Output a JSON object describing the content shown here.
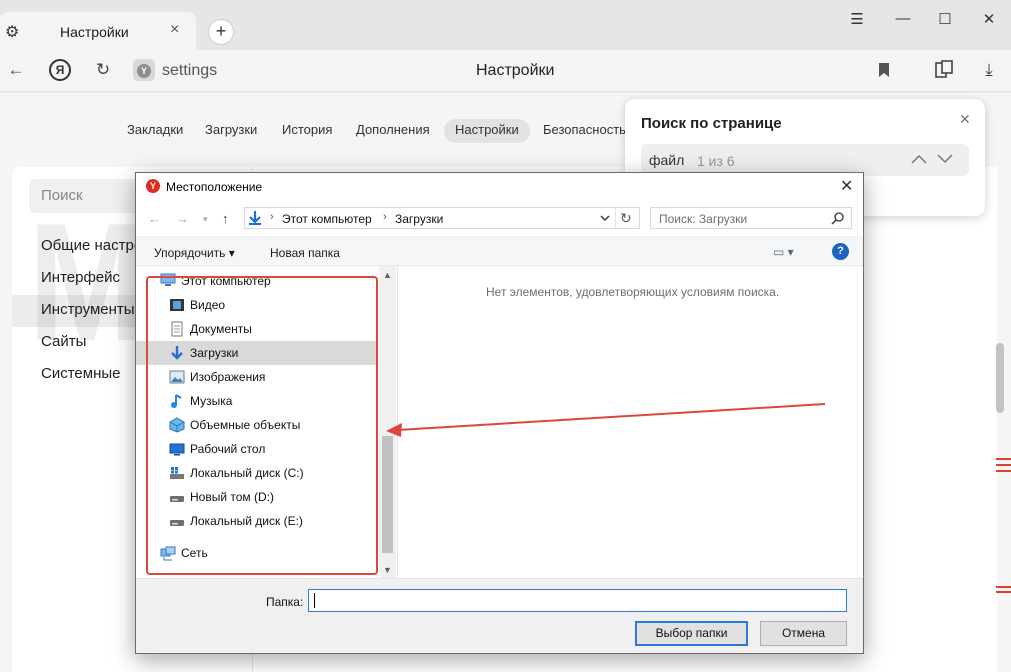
{
  "browser": {
    "tab_title": "Настройки",
    "tab_close": "×",
    "new_tab": "+",
    "url": "settings",
    "page_title": "Настройки",
    "logo_letter": "Я",
    "site_badge": "Y"
  },
  "settings": {
    "nav": [
      "Закладки",
      "Загрузки",
      "История",
      "Дополнения",
      "Настройки",
      "Безопасность"
    ],
    "active_nav": "Настройки",
    "search_placeholder": "Поиск",
    "sidebar": [
      "Общие настройки",
      "Интерфейс",
      "Инструменты",
      "Сайты",
      "Системные"
    ],
    "active_sidebar": "Инструменты"
  },
  "find_bar": {
    "title": "Поиск по странице",
    "query": "файл",
    "count": "1 из 6"
  },
  "watermark": "MARREX.RU",
  "dialog": {
    "title": "Местоположение",
    "icon_letter": "Y",
    "address": [
      "Этот компьютер",
      "Загрузки"
    ],
    "search_placeholder": "Поиск: Загрузки",
    "commands": {
      "organize": "Упорядочить",
      "new_folder": "Новая папка"
    },
    "tree": [
      {
        "label": "Этот компьютер",
        "icon": "computer-icon",
        "level": 0
      },
      {
        "label": "Видео",
        "icon": "video-icon",
        "level": 1
      },
      {
        "label": "Документы",
        "icon": "documents-icon",
        "level": 1
      },
      {
        "label": "Загрузки",
        "icon": "downloads-icon",
        "level": 1,
        "selected": true
      },
      {
        "label": "Изображения",
        "icon": "images-icon",
        "level": 1
      },
      {
        "label": "Музыка",
        "icon": "music-icon",
        "level": 1
      },
      {
        "label": "Объемные объекты",
        "icon": "3d-objects-icon",
        "level": 1
      },
      {
        "label": "Рабочий стол",
        "icon": "desktop-icon",
        "level": 1
      },
      {
        "label": "Локальный диск (C:)",
        "icon": "drive-c-icon",
        "level": 1
      },
      {
        "label": "Новый том (D:)",
        "icon": "drive-icon",
        "level": 1
      },
      {
        "label": "Локальный диск (E:)",
        "icon": "drive-icon",
        "level": 1
      },
      {
        "label": "Сеть",
        "icon": "network-icon",
        "level": 0
      }
    ],
    "empty_message": "Нет элементов, удовлетворяющих условиям поиска.",
    "folder_label": "Папка:",
    "folder_value": "",
    "select_button": "Выбор папки",
    "cancel_button": "Отмена"
  },
  "colors": {
    "annotation_red": "#d9473d",
    "accent_blue": "#2b7ad6"
  }
}
